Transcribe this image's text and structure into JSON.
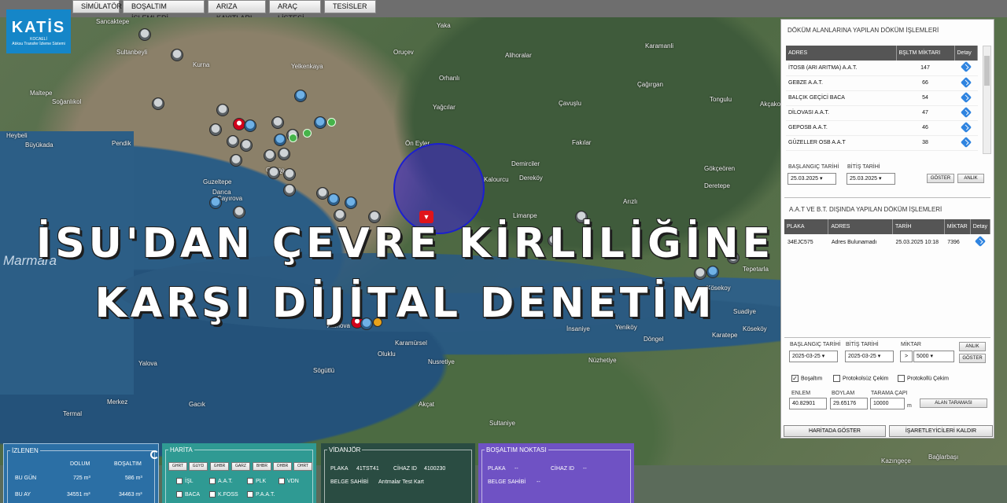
{
  "menu": [
    "SİMÜLATÖR",
    "BOŞALTIM İŞLEMLERİ",
    "ARIZA KAYITLARI",
    "ARAÇ LİSTESİ",
    "TESİSLER"
  ],
  "logo": {
    "text": "KATİS",
    "sub1": "KOCAELİ",
    "sub2": "Atıksu Transfer İzleme Sistemi"
  },
  "headline": {
    "line1": "İSU'DAN ÇEVRE KİRLİLİĞİNE",
    "line2": "KARŞI DİJİTAL DENETİM"
  },
  "map": {
    "labels": [
      "Sancaktepe",
      "Sultanbeyli",
      "Kurna",
      "Maltepe",
      "Soğanlıkol",
      "Heybeli",
      "Büyükada",
      "Pendik",
      "Gebze",
      "Yelkenkaya",
      "Orhanlı",
      "Yağcılar",
      "Alihoralar",
      "Çavuşlu",
      "Karamanli",
      "Çağırgan",
      "Tongulu",
      "Akçakoca",
      "Gökçeören",
      "Deretepe",
      "Arızlı",
      "Fakılar",
      "Demirciler",
      "Dereköy",
      "Kalourcu",
      "Limanpe",
      "Kösekoy",
      "Karatepe",
      "Yeniköy",
      "Döngel",
      "İnsaniye",
      "Suadiye",
      "Köseköy",
      "Tepetarla",
      "Bağlarbaşı",
      "Kazıngeçe",
      "Sultaniye",
      "Nüzhetiye",
      "Nusretiye",
      "Akçat",
      "Yalova",
      "Termal",
      "Merkez",
      "Gacık",
      "Oluklu",
      "Sögütlü",
      "Karamürsel",
      "Altınova",
      "Darıca",
      "Çayırova",
      "Guzeltepe",
      "Gebze",
      "Yaka",
      "Oruçev",
      "Ön Eyler",
      "Marmara"
    ],
    "colors": {
      "water": "#2b5a81",
      "circle": "#3c28be",
      "marker": "#e0141b"
    }
  },
  "panel": {
    "section1_title": "DÖKÜM ALANLARINA YAPILAN DÖKÜM İŞLEMLERİ",
    "t1_headers": [
      "ADRES",
      "BŞLTM MİKTARI",
      "Detay"
    ],
    "t1_rows": [
      {
        "adres": "İTOSB (ARI ARITMA) A.A.T.",
        "miktar": "147"
      },
      {
        "adres": "GEBZE A.A.T.",
        "miktar": "66"
      },
      {
        "adres": "BALÇIK GEÇİCİ BACA",
        "miktar": "54"
      },
      {
        "adres": "DİLOVASI A.A.T.",
        "miktar": "47"
      },
      {
        "adres": "GEPOSB A.A.T.",
        "miktar": "46"
      },
      {
        "adres": "GÜZELLER OSB A.A.T",
        "miktar": "38"
      }
    ],
    "start_label": "BAŞLANGIÇ TARİHİ",
    "end_label": "BİTİŞ TARİHİ",
    "start_date": "25.03.2025",
    "end_date": "25.03.2025",
    "goster": "GÖSTER",
    "anlik": "ANLIK",
    "section2_title": "A.A.T ve B.T. DIŞINDA YAPILAN DÖKÜM İŞLEMLERİ",
    "t2_headers": [
      "PLAKA",
      "ADRES",
      "TARİH",
      "MİKTAR",
      "Detay"
    ],
    "t2_rows": [
      {
        "plaka": "34EJC575",
        "adres": "Adres Bulunamadı",
        "tarih": "25.03.2025 10:18",
        "miktar": "7396"
      }
    ],
    "f_start_label": "BAŞLANGIÇ TARİHİ",
    "f_end_label": "BİTİŞ TARİHİ",
    "f_miktar_label": "MİKTAR",
    "f_start": "2025-03-25",
    "f_end": "2025-03-25",
    "f_op": ">",
    "f_miktar": "5000",
    "f_anlik": "ANLIK",
    "f_goster": "GÖSTER",
    "chk_bosaltim": "Boşaltım",
    "chk_protokolsuz": "Protokolsüz Çekim",
    "chk_protokollu": "Protokollü Çekim",
    "enlem_label": "ENLEM",
    "boylam_label": "BOYLAM",
    "cap_label": "TARAMA ÇAPI",
    "enlem": "40.82901",
    "boylam": "29.65176",
    "cap": "10000",
    "cap_unit": "m",
    "alan_taramasi": "ALAN TARAMASI",
    "haritada_goster": "HARİTADA GÖSTER",
    "isaretleyici_kaldir": "İŞARETLEYİCİLERİ KALDIR"
  },
  "izlenen": {
    "title": "İZLENEN",
    "col1": "DOLUM",
    "col2": "BOŞALTIM",
    "row1_label": "BU GÜN",
    "row1_dolum": "725 m³",
    "row1_bos": "586 m³",
    "row2_label": "BU AY",
    "row2_dolum": "34551 m³",
    "row2_bos": "34463 m³"
  },
  "harita": {
    "title": "HARİTA",
    "buttons": [
      "GHRT",
      "GUYD",
      "GHBR",
      "GARZ",
      "BHBR",
      "OHBR",
      "OHRT"
    ],
    "checks": [
      {
        "label": "İŞL",
        "checked": false
      },
      {
        "label": "A.A.T.",
        "checked": false
      },
      {
        "label": "PLK",
        "checked": false
      },
      {
        "label": "VDN",
        "checked": true
      },
      {
        "label": "BACA",
        "checked": false
      },
      {
        "label": "K.FOSS",
        "checked": false
      },
      {
        "label": "P.A.A.T.",
        "checked": false
      }
    ]
  },
  "vidanjor": {
    "title": "VİDANJÖR",
    "plaka_label": "PLAKA",
    "plaka": "41TST41",
    "cihaz_label": "CİHAZ ID",
    "cihaz": "4100230",
    "belge_label": "BELGE SAHİBİ",
    "belge": "Arıtmalar Test Kart"
  },
  "bosaltim": {
    "title": "BOŞALTIM NOKTASI",
    "plaka_label": "PLAKA",
    "plaka": "--",
    "cihaz_label": "CİHAZ ID",
    "cihaz": "--",
    "belge_label": "BELGE SAHİBİ",
    "belge": "--"
  }
}
